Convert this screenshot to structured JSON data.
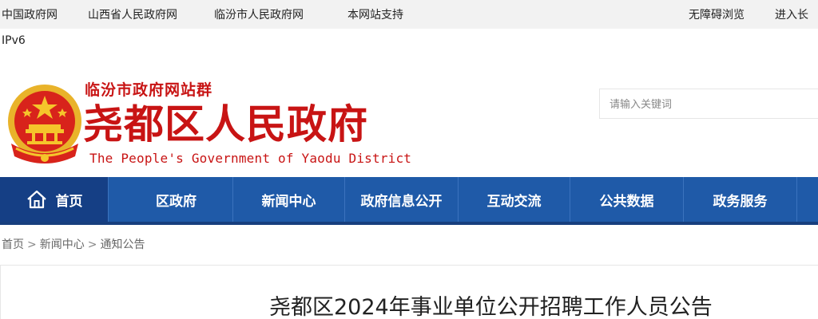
{
  "topbar": {
    "links": [
      "中国政府网",
      "山西省人民政府网",
      "临汾市人民政府网",
      "本网站支持"
    ],
    "accessibility": "无障碍浏览",
    "enter": "进入长"
  },
  "ipv6": "IPv6",
  "header": {
    "group": "临汾市政府网站群",
    "title": "尧都区人民政府",
    "subtitle_en": "The People's Government of Yaodu District"
  },
  "search": {
    "placeholder": "请输入关键词"
  },
  "nav": {
    "items": [
      "首页",
      "区政府",
      "新闻中心",
      "政府信息公开",
      "互动交流",
      "公共数据",
      "政务服务"
    ]
  },
  "breadcrumb": [
    "首页",
    "新闻中心",
    "通知公告"
  ],
  "breadcrumb_sep": ">",
  "article": {
    "title": "尧都区2024年事业单位公开招聘工作人员公告"
  },
  "colors": {
    "brand_red": "#c81414",
    "nav_blue": "#1f5aa8",
    "nav_active": "#153f85"
  }
}
